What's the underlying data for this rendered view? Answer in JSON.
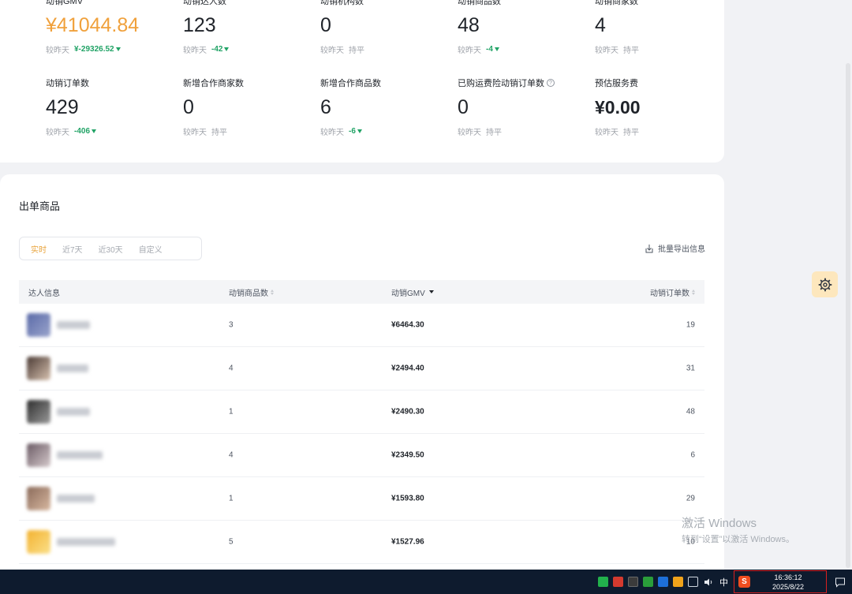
{
  "stats": {
    "compare_label": "较昨天",
    "row1": [
      {
        "label": "动销GMV",
        "value": "¥41044.84",
        "delta": "¥-29326.52",
        "trend": "down",
        "highlight": true
      },
      {
        "label": "动销达人数",
        "value": "123",
        "delta": "-42",
        "trend": "down"
      },
      {
        "label": "动销机构数",
        "value": "0",
        "delta": "持平",
        "trend": "flat"
      },
      {
        "label": "动销商品数",
        "value": "48",
        "delta": "-4",
        "trend": "down"
      },
      {
        "label": "动销商家数",
        "value": "4",
        "delta": "持平",
        "trend": "flat"
      }
    ],
    "row2": [
      {
        "label": "动销订单数",
        "value": "429",
        "delta": "-406",
        "trend": "down"
      },
      {
        "label": "新增合作商家数",
        "value": "0",
        "delta": "持平",
        "trend": "flat"
      },
      {
        "label": "新增合作商品数",
        "value": "6",
        "delta": "-6",
        "trend": "down"
      },
      {
        "label": "已购运费险动销订单数",
        "value": "0",
        "delta": "持平",
        "trend": "flat",
        "help": "?"
      },
      {
        "label": "预估服务费",
        "value": "¥0.00",
        "delta": "持平",
        "trend": "flat"
      }
    ]
  },
  "products": {
    "title": "出单商品",
    "tabs": [
      "实时",
      "近7天",
      "近30天",
      "自定义"
    ],
    "active_tab": "实时",
    "export_label": "批量导出信息",
    "columns": {
      "influencer": "达人信息",
      "product_count": "动销商品数",
      "gmv": "动销GMV",
      "orders": "动销订单数"
    },
    "rows": [
      {
        "product_count": "3",
        "gmv": "¥6464.30",
        "orders": "19"
      },
      {
        "product_count": "4",
        "gmv": "¥2494.40",
        "orders": "31"
      },
      {
        "product_count": "1",
        "gmv": "¥2490.30",
        "orders": "48"
      },
      {
        "product_count": "4",
        "gmv": "¥2349.50",
        "orders": "6"
      },
      {
        "product_count": "1",
        "gmv": "¥1593.80",
        "orders": "29"
      },
      {
        "product_count": "5",
        "gmv": "¥1527.96",
        "orders": "10"
      }
    ]
  },
  "watermark": {
    "line1": "激活 Windows",
    "line2": "转到“设置”以激活 Windows。"
  },
  "taskbar": {
    "ime_label": "中",
    "time": "16:36:12",
    "date": "2025/8/22"
  },
  "colors": {
    "accent_orange": "#f0a13c",
    "down_green": "#21a366",
    "gear_bg": "#fde7bd"
  }
}
